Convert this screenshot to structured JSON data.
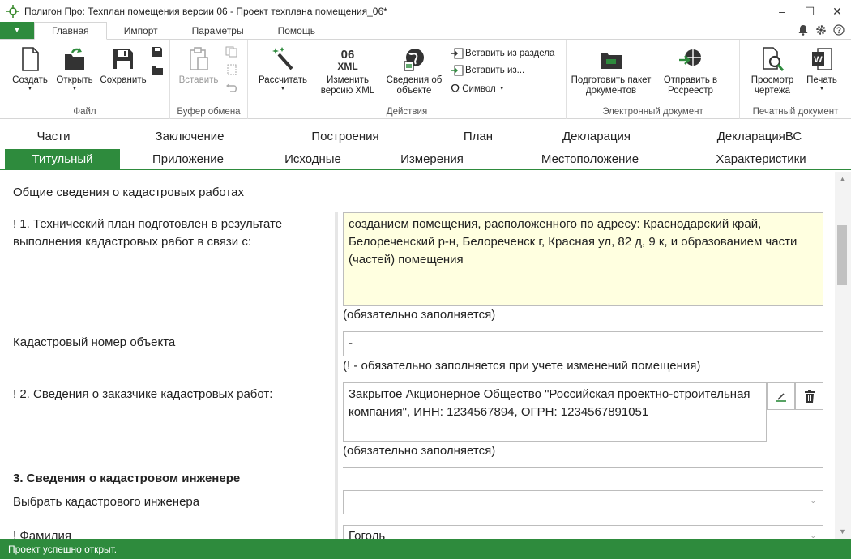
{
  "window": {
    "title": "Полигон Про: Техплан помещения версии 06 - Проект техплана помещения_06*",
    "minimize_glyph": "–",
    "maximize_glyph": "☐",
    "close_glyph": "✕"
  },
  "ribbon_tabs": {
    "file_arrow": "▼",
    "tabs": [
      "Главная",
      "Импорт",
      "Параметры",
      "Помощь"
    ]
  },
  "ribbon": {
    "groups": {
      "file": {
        "label": "Файл",
        "create": "Создать",
        "open": "Открыть",
        "save": "Сохранить"
      },
      "clipboard": {
        "label": "Буфер обмена",
        "paste": "Вставить"
      },
      "actions": {
        "label": "Действия",
        "calculate": "Рассчитать",
        "change_xml_line1": "Изменить",
        "change_xml_line2": "версию XML",
        "icon_06": "06",
        "icon_xml": "XML",
        "object_info_line1": "Сведения об",
        "object_info_line2": "объекте",
        "insert_from_section": "Вставить из раздела",
        "insert_from": "Вставить из...",
        "symbol": "Символ"
      },
      "edoc": {
        "label": "Электронный документ",
        "prepare_line1": "Подготовить пакет",
        "prepare_line2": "документов",
        "send_line1": "Отправить в",
        "send_line2": "Росреестр"
      },
      "print": {
        "label": "Печатный документ",
        "preview_line1": "Просмотр",
        "preview_line2": "чертежа",
        "print": "Печать"
      }
    }
  },
  "section_tabs": {
    "row1": [
      "Части",
      "Заключение",
      "Построения",
      "План",
      "Декларация",
      "ДекларацияВС"
    ],
    "row2": [
      "Титульный",
      "Приложение",
      "Исходные",
      "Измерения",
      "Местоположение",
      "Характеристики"
    ],
    "active": "Титульный"
  },
  "form": {
    "section_title": "Общие сведения о кадастровых работах",
    "reason_label": "! 1. Технический план подготовлен в результате выполнения кадастровых работ в связи с:",
    "reason_value": "созданием помещения, расположенного по адресу: Краснодарский край, Белореченский р-н, Белореченск г, Красная ул, 82 д, 9 к, и образованием части (частей) помещения",
    "reason_hint": "(обязательно заполняется)",
    "cadastral_label": "Кадастровый номер объекта",
    "cadastral_value": "-",
    "cadastral_hint": "(! - обязательно заполняется при учете изменений помещения)",
    "customer_label": "! 2. Сведения о заказчике кадастровых работ:",
    "customer_value": "Закрытое Акционерное Общество \"Российская проектно-строительная компания\", ИНН: 1234567894, ОГРН: 1234567891051",
    "customer_hint": "(обязательно заполняется)",
    "engineer_section": "3. Сведения о кадастровом инженере",
    "choose_engineer_label": "Выбрать кадастрового инженера",
    "choose_engineer_value": "",
    "surname_label": "! Фамилия",
    "surname_value": "Гоголь"
  },
  "status": {
    "text": "Проект успешно открыт."
  },
  "colors": {
    "accent": "#2e8b3d",
    "field_highlight": "#ffffe0"
  }
}
